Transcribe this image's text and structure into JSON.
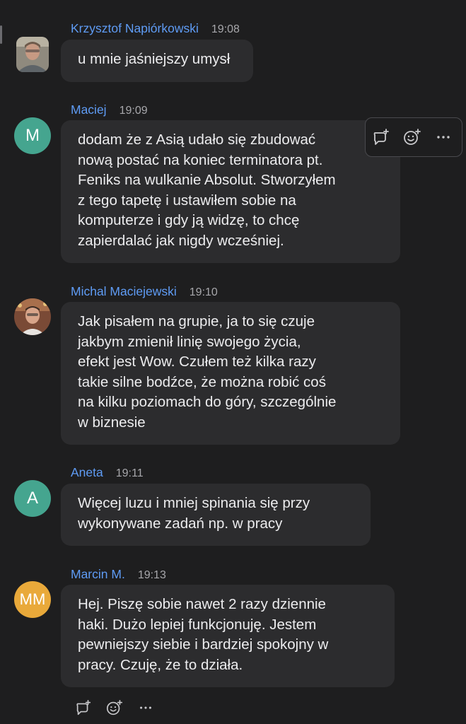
{
  "messages": [
    {
      "author": "Krzysztof Napiórkowski",
      "time": "19:08",
      "avatar": {
        "kind": "photo",
        "icon": "user-photo-krzysztof"
      },
      "lines": [
        "u mnie jaśniejszy umysł"
      ]
    },
    {
      "author": "Maciej",
      "time": "19:09",
      "avatar": {
        "kind": "initials",
        "initials": "M",
        "color": "#45a58f"
      },
      "lines": [
        "dodam że z Asią udało się zbudować",
        "nową postać na koniec terminatora pt.",
        "Feniks na wulkanie Absolut. Stworzyłem",
        "z tego tapetę i ustawiłem sobie na",
        "komputerze i gdy ją widzę, to chcę",
        "zapierdalać jak nigdy wcześniej."
      ]
    },
    {
      "author": "Michal Maciejewski",
      "time": "19:10",
      "avatar": {
        "kind": "photo",
        "icon": "user-photo-michal"
      },
      "lines": [
        "Jak pisałem na grupie, ja to się czuje",
        "jakbym zmienił linię swojego życia,",
        "efekt jest Wow. Czułem też kilka razy",
        "takie silne bodźce, że można robić coś",
        "na kilku poziomach do góry, szczególnie",
        "w biznesie"
      ]
    },
    {
      "author": "Aneta",
      "time": "19:11",
      "avatar": {
        "kind": "initials",
        "initials": "A",
        "color": "#45a58f"
      },
      "lines": [
        "Więcej luzu i mniej spinania się przy",
        "wykonywane zadań np. w pracy"
      ]
    },
    {
      "author": "Marcin M.",
      "time": "19:13",
      "avatar": {
        "kind": "initials",
        "initials": "MM",
        "color": "#e9a93a"
      },
      "lines": [
        "Hej. Piszę sobie nawet 2 razy dziennie",
        "haki. Dużo lepiej funkcjonuję. Jestem",
        "pewniejszy siebie i bardziej spokojny w",
        "pracy. Czuję, że to działa."
      ]
    }
  ],
  "hover_actions": [
    "reply-in-thread-icon",
    "add-reaction-icon",
    "more-options-icon"
  ],
  "colors": {
    "background": "#1e1e1f",
    "bubble": "#2c2c2e",
    "name": "#5f9cf5",
    "time": "#a7a7ab"
  }
}
